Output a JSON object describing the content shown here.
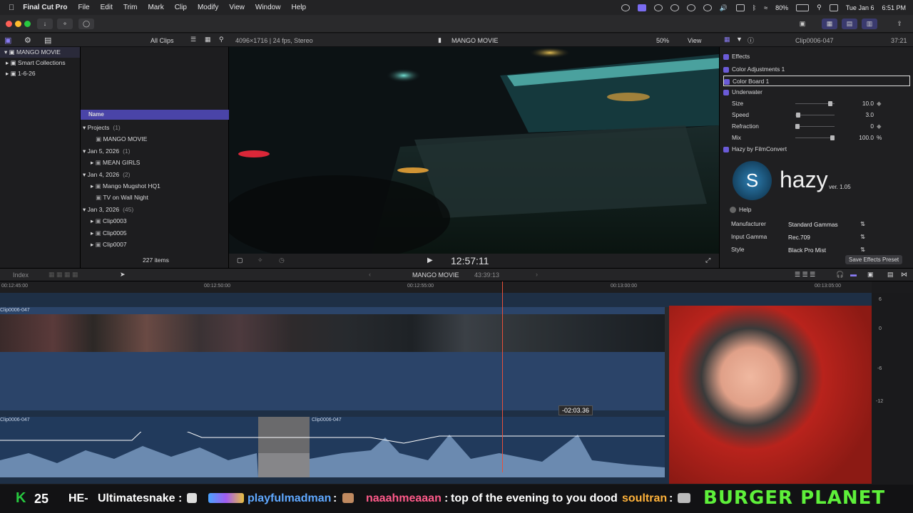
{
  "menubar": {
    "app": "Final Cut Pro",
    "items": [
      "File",
      "Edit",
      "Trim",
      "Mark",
      "Clip",
      "Modify",
      "View",
      "Window",
      "Help"
    ],
    "battery": "80%",
    "date": "Tue Jan 6",
    "time": "6:51 PM"
  },
  "browser_header": {
    "filter": "All Clips",
    "format": "4096×1716 | 24 fps, Stereo"
  },
  "viewer_header": {
    "title": "MANGO MOVIE",
    "zoom": "50%",
    "view": "View"
  },
  "library": {
    "root": "MANGO MOVIE",
    "items": [
      "Smart Collections",
      "1-6-26"
    ]
  },
  "browser": {
    "column": "Name",
    "count": "227 items",
    "rows": [
      {
        "label": "Projects",
        "count": "(1)",
        "level": 0,
        "type": "group"
      },
      {
        "label": "MANGO MOVIE",
        "count": "",
        "level": 1,
        "type": "item"
      },
      {
        "label": "Jan 5, 2026",
        "count": "(1)",
        "level": 0,
        "type": "group"
      },
      {
        "label": "MEAN GIRLS",
        "count": "",
        "level": 1,
        "type": "item"
      },
      {
        "label": "Jan 4, 2026",
        "count": "(2)",
        "level": 0,
        "type": "group"
      },
      {
        "label": "Mango Mugshot HQ1",
        "count": "",
        "level": 1,
        "type": "item"
      },
      {
        "label": "TV on Wall Night",
        "count": "",
        "level": 1,
        "type": "item"
      },
      {
        "label": "Jan 3, 2026",
        "count": "(45)",
        "level": 0,
        "type": "group"
      },
      {
        "label": "Clip0003",
        "count": "",
        "level": 1,
        "type": "item"
      },
      {
        "label": "Clip0005",
        "count": "",
        "level": 1,
        "type": "item"
      },
      {
        "label": "Clip0007",
        "count": "",
        "level": 1,
        "type": "item"
      }
    ]
  },
  "viewer": {
    "timecode": "12:57:11"
  },
  "inspector": {
    "clip": "Clip0006-047",
    "duration": "37:21",
    "section": "Effects",
    "effects": [
      "Color Adjustments 1",
      "Color Board 1",
      "Underwater"
    ],
    "params": [
      {
        "name": "Size",
        "value": "10.0",
        "level": 0.93
      },
      {
        "name": "Speed",
        "value": "3.0",
        "level": 0.03
      },
      {
        "name": "Refraction",
        "value": "0",
        "level": 0
      },
      {
        "name": "Mix",
        "value": "100.0",
        "unit": "%",
        "level": 1
      }
    ],
    "plugin": "Hazy by FilmConvert",
    "logo": "hazy",
    "version": "ver. 1.05",
    "help": "Help",
    "settings": [
      {
        "name": "Manufacturer",
        "value": "Standard Gammas"
      },
      {
        "name": "Input Gamma",
        "value": "Rec.709"
      },
      {
        "name": "Style",
        "value": "Black Pro Mist"
      }
    ],
    "save_button": "Save Effects Preset"
  },
  "timeline_bar": {
    "index": "Index",
    "project": "MANGO MOVIE",
    "duration": "43:39:13"
  },
  "ruler": [
    "00:12:45:00",
    "00:12:50:00",
    "00:12:55:00",
    "00:13:00:00",
    "00:13:05:00"
  ],
  "timeline": {
    "clip_name": "Clip0006-047",
    "audio_name_left": "Clip0006-047",
    "audio_name_right": "Clip0006-047",
    "tooltip": "-02:03.36",
    "meter": [
      "6",
      "0",
      "-6",
      "-12"
    ]
  },
  "chat": {
    "count": "25",
    "messages": [
      {
        "user": "HE-",
        "text": ""
      },
      {
        "user": "Ultimatesnake",
        "text": ""
      },
      {
        "user": "playfulmadman",
        "text": ""
      },
      {
        "user": "naaahmeaaan",
        "text": "top of the evening to you dood"
      },
      {
        "user": "soultran",
        "text": ""
      }
    ],
    "banner": "BURGER PLANET"
  },
  "colors": {
    "accent": "#6b5bd8",
    "playhead": "#e8503a",
    "timeline_bg": "#1e2f45",
    "chat_green": "#27c93f",
    "chat_banner": "#5ef03a"
  }
}
